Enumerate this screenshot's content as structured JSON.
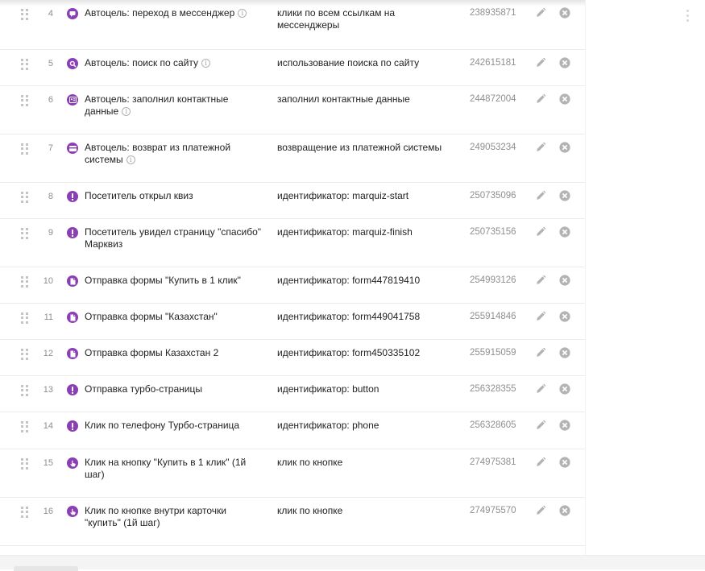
{
  "goals": [
    {
      "num": "4",
      "icon": "message-icon",
      "name": "Автоцель: переход в мессенджер",
      "info": true,
      "condition": "клики по всем ссылкам на мессенджеры",
      "id": "238935871"
    },
    {
      "num": "5",
      "icon": "search-icon",
      "name": "Автоцель: поиск по сайту",
      "info": true,
      "condition": "использование поиска по сайту",
      "id": "242615181"
    },
    {
      "num": "6",
      "icon": "contact-card-icon",
      "name": "Автоцель: заполнил контактные данные",
      "info": true,
      "condition": "заполнил контактные данные",
      "id": "244872004"
    },
    {
      "num": "7",
      "icon": "payment-card-icon",
      "name": "Автоцель: возврат из платежной системы",
      "info": true,
      "condition": "возвращение из платежной системы",
      "id": "249053234"
    },
    {
      "num": "8",
      "icon": "exclamation-icon",
      "name": "Посетитель открыл квиз",
      "info": false,
      "condition": "идентификатор: marquiz-start",
      "id": "250735096"
    },
    {
      "num": "9",
      "icon": "exclamation-icon",
      "name": "Посетитель увидел страницу \"спасибо\" Марквиз",
      "info": false,
      "condition": "идентификатор: marquiz-finish",
      "id": "250735156"
    },
    {
      "num": "10",
      "icon": "form-icon",
      "name": "Отправка формы \"Купить в 1 клик\"",
      "info": false,
      "condition": "идентификатор: form447819410",
      "id": "254993126"
    },
    {
      "num": "11",
      "icon": "form-icon",
      "name": "Отправка формы \"Казахстан\"",
      "info": false,
      "condition": "идентификатор: form449041758",
      "id": "255914846"
    },
    {
      "num": "12",
      "icon": "form-icon",
      "name": "Отправка формы Казахстан 2",
      "info": false,
      "condition": "идентификатор: form450335102",
      "id": "255915059"
    },
    {
      "num": "13",
      "icon": "exclamation-icon",
      "name": "Отправка турбо-страницы",
      "info": false,
      "condition": "идентификатор: button",
      "id": "256328355"
    },
    {
      "num": "14",
      "icon": "exclamation-icon",
      "name": "Клик по телефону Турбо-страница",
      "info": false,
      "condition": "идентификатор: phone",
      "id": "256328605"
    },
    {
      "num": "15",
      "icon": "click-icon",
      "name": "Клик на кнопку \"Купить в 1 клик\" (1й шаг)",
      "info": false,
      "condition": "клик по кнопке",
      "id": "274975381"
    },
    {
      "num": "16",
      "icon": "click-icon",
      "name": "Клик по кнопке внутри карточки \"купить\" (1й шаг)",
      "info": false,
      "condition": "клик по кнопке",
      "id": "274975570"
    }
  ],
  "colors": {
    "accent": "#8a3fb4",
    "muted": "#8f8f8f",
    "action_icon": "#b3b3b3"
  },
  "info_glyph": "i"
}
